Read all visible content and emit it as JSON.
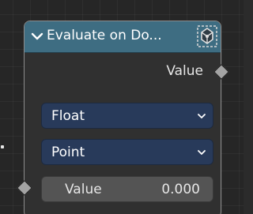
{
  "node": {
    "title": "Evaluate on Do...",
    "header_color": "#3e6d82",
    "collapse_icon": "chevron-down-icon",
    "header_icon": "node-group-icon",
    "output": {
      "label": "Value",
      "socket_color": "#a3a3a3",
      "socket_shape": "diamond"
    },
    "data_type_dropdown": {
      "selected": "Float",
      "icon": "chevron-down-icon"
    },
    "domain_dropdown": {
      "selected": "Point",
      "icon": "chevron-down-icon"
    },
    "input": {
      "label": "Value",
      "value": "0.000",
      "socket_color": "#a3a3a3",
      "socket_shape": "diamond"
    }
  }
}
